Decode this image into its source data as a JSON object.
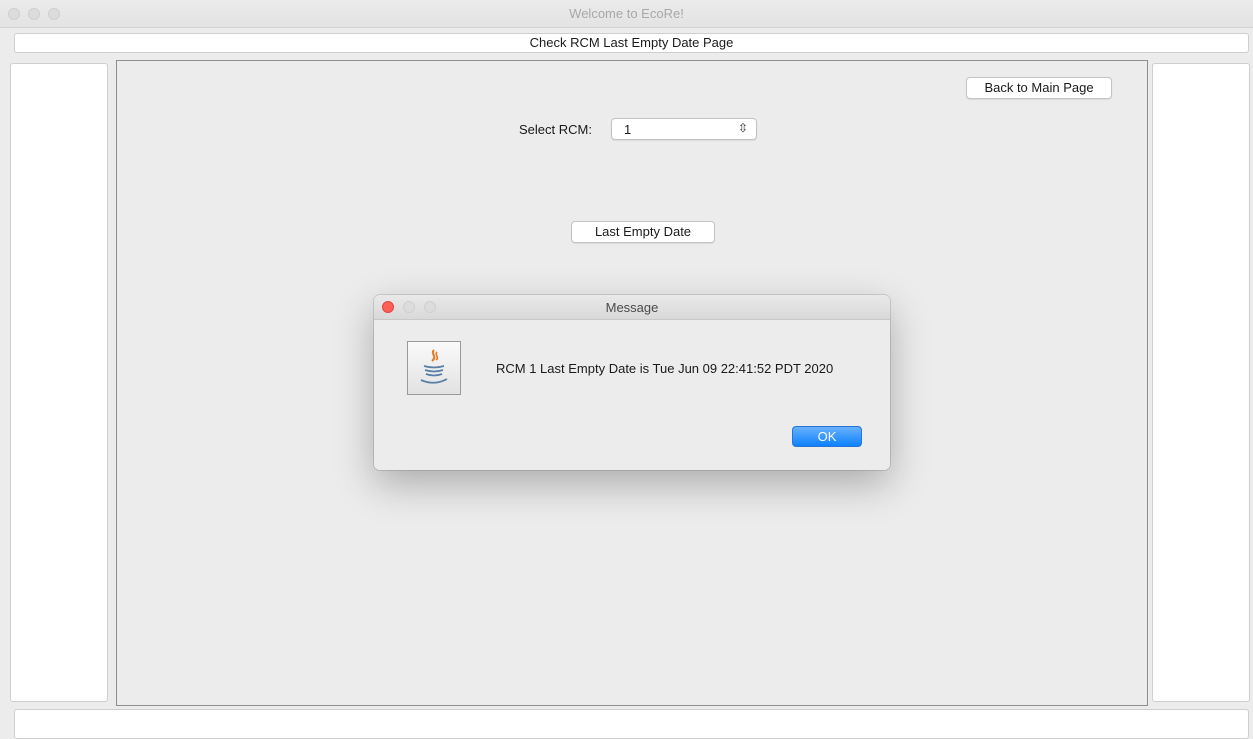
{
  "window": {
    "title": "Welcome to EcoRe!"
  },
  "page": {
    "title": "Check RCM Last Empty Date Page"
  },
  "main": {
    "back_button": "Back to Main Page",
    "select_label": "Select RCM:",
    "select_value": "1",
    "last_empty_button": "Last Empty Date"
  },
  "dialog": {
    "title": "Message",
    "message": "RCM 1 Last Empty Date is Tue Jun 09 22:41:52 PDT 2020",
    "ok_label": "OK",
    "icon": "java-icon"
  },
  "colors": {
    "accent": "#0d81ff",
    "close_red": "#fe5f57",
    "panel_bg": "#ececec"
  }
}
